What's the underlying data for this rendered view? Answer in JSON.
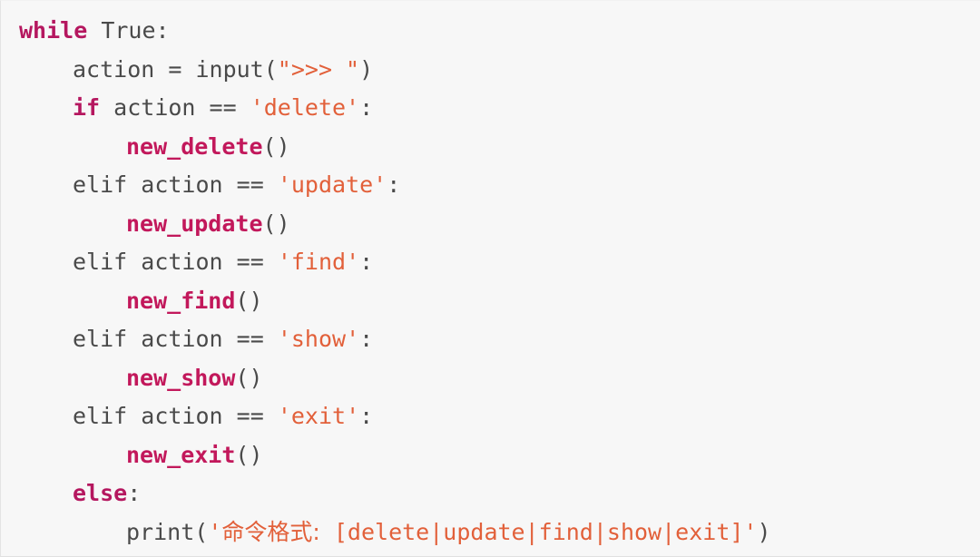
{
  "editor": {
    "language": "python",
    "background_color": "#f7f7f7",
    "colors": {
      "keyword": "#b5175f",
      "function": "#c2185b",
      "string": "#e2603a",
      "plain": "#4a4a4a"
    },
    "lines": [
      {
        "indent": 0,
        "tokens": [
          {
            "t": "while",
            "k": "kw"
          },
          {
            "t": " ",
            "k": "plain"
          },
          {
            "t": "True",
            "k": "plain"
          },
          {
            "t": ":",
            "k": "punct"
          }
        ]
      },
      {
        "indent": 1,
        "tokens": [
          {
            "t": "action",
            "k": "plain"
          },
          {
            "t": " = ",
            "k": "op"
          },
          {
            "t": "input",
            "k": "plain"
          },
          {
            "t": "(",
            "k": "punct"
          },
          {
            "t": "\">>> \"",
            "k": "str"
          },
          {
            "t": ")",
            "k": "punct"
          }
        ]
      },
      {
        "indent": 1,
        "tokens": [
          {
            "t": "if",
            "k": "kw"
          },
          {
            "t": " action ",
            "k": "plain"
          },
          {
            "t": "==",
            "k": "op"
          },
          {
            "t": " ",
            "k": "plain"
          },
          {
            "t": "'delete'",
            "k": "str"
          },
          {
            "t": ":",
            "k": "punct"
          }
        ]
      },
      {
        "indent": 2,
        "tokens": [
          {
            "t": "new_delete",
            "k": "fn"
          },
          {
            "t": "()",
            "k": "punct"
          }
        ]
      },
      {
        "indent": 1,
        "tokens": [
          {
            "t": "elif",
            "k": "plain"
          },
          {
            "t": " action ",
            "k": "plain"
          },
          {
            "t": "==",
            "k": "op"
          },
          {
            "t": " ",
            "k": "plain"
          },
          {
            "t": "'update'",
            "k": "str"
          },
          {
            "t": ":",
            "k": "punct"
          }
        ]
      },
      {
        "indent": 2,
        "tokens": [
          {
            "t": "new_update",
            "k": "fn"
          },
          {
            "t": "()",
            "k": "punct"
          }
        ]
      },
      {
        "indent": 1,
        "tokens": [
          {
            "t": "elif",
            "k": "plain"
          },
          {
            "t": " action ",
            "k": "plain"
          },
          {
            "t": "==",
            "k": "op"
          },
          {
            "t": " ",
            "k": "plain"
          },
          {
            "t": "'find'",
            "k": "str"
          },
          {
            "t": ":",
            "k": "punct"
          }
        ]
      },
      {
        "indent": 2,
        "tokens": [
          {
            "t": "new_find",
            "k": "fn"
          },
          {
            "t": "()",
            "k": "punct"
          }
        ]
      },
      {
        "indent": 1,
        "tokens": [
          {
            "t": "elif",
            "k": "plain"
          },
          {
            "t": " action ",
            "k": "plain"
          },
          {
            "t": "==",
            "k": "op"
          },
          {
            "t": " ",
            "k": "plain"
          },
          {
            "t": "'show'",
            "k": "str"
          },
          {
            "t": ":",
            "k": "punct"
          }
        ]
      },
      {
        "indent": 2,
        "tokens": [
          {
            "t": "new_show",
            "k": "fn"
          },
          {
            "t": "()",
            "k": "punct"
          }
        ]
      },
      {
        "indent": 1,
        "tokens": [
          {
            "t": "elif",
            "k": "plain"
          },
          {
            "t": " action ",
            "k": "plain"
          },
          {
            "t": "==",
            "k": "op"
          },
          {
            "t": " ",
            "k": "plain"
          },
          {
            "t": "'exit'",
            "k": "str"
          },
          {
            "t": ":",
            "k": "punct"
          }
        ]
      },
      {
        "indent": 2,
        "tokens": [
          {
            "t": "new_exit",
            "k": "fn"
          },
          {
            "t": "()",
            "k": "punct"
          }
        ]
      },
      {
        "indent": 1,
        "tokens": [
          {
            "t": "else",
            "k": "kw"
          },
          {
            "t": ":",
            "k": "punct"
          }
        ]
      },
      {
        "indent": 2,
        "tokens": [
          {
            "t": "print",
            "k": "plain"
          },
          {
            "t": "(",
            "k": "punct"
          },
          {
            "t": "'",
            "k": "str"
          },
          {
            "t": "命令格式:",
            "k": "cjk"
          },
          {
            "t": " [delete|update|find|show|exit]'",
            "k": "str"
          },
          {
            "t": ")",
            "k": "punct"
          }
        ]
      }
    ]
  }
}
